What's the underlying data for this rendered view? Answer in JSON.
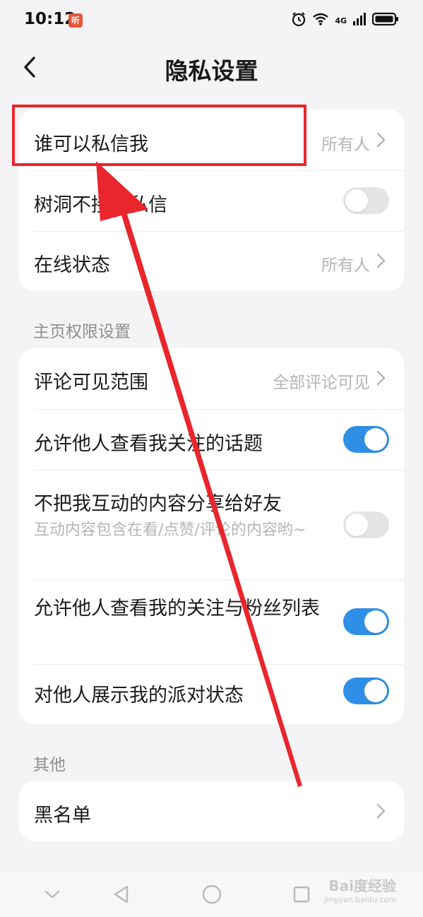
{
  "status_bar": {
    "time": "10:12",
    "app_badge": "听",
    "network": "4G"
  },
  "header": {
    "title": "隐私设置"
  },
  "group1": {
    "rows": [
      {
        "label": "谁可以私信我",
        "value": "所有人"
      },
      {
        "label": "树洞不接受私信",
        "toggle": false
      },
      {
        "label": "在线状态",
        "value": "所有人"
      }
    ]
  },
  "homepage_section": {
    "title": "主页权限设置",
    "rows": [
      {
        "label": "评论可见范围",
        "value": "全部评论可见"
      },
      {
        "label": "允许他人查看我关注的话题",
        "toggle": true
      },
      {
        "label": "不把我互动的内容分享给好友",
        "sublabel": "互动内容包含在看/点赞/评论的内容哟~",
        "toggle": false
      },
      {
        "label": "允许他人查看我的关注与粉丝列表",
        "toggle": true
      },
      {
        "label": "对他人展示我的派对状态",
        "toggle": true
      }
    ]
  },
  "other_section": {
    "title": "其他",
    "rows": [
      {
        "label": "黑名单"
      }
    ]
  },
  "watermark": {
    "text": "Bai度经验",
    "sub": "jingyan.baidu.com"
  },
  "colors": {
    "accent": "#2f8fe6",
    "annotation": "#e8262c",
    "background": "#f4f4f6"
  }
}
